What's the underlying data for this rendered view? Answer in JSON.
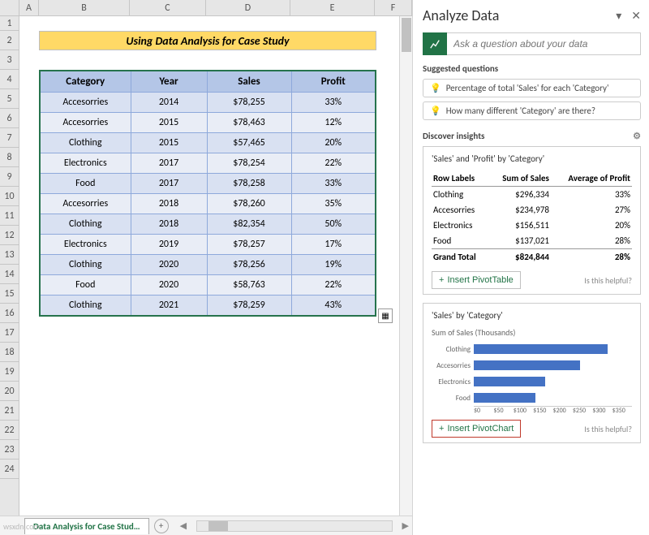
{
  "columns": [
    "A",
    "B",
    "C",
    "D",
    "E",
    "F"
  ],
  "rows": [
    "1",
    "2",
    "3",
    "4",
    "5",
    "6",
    "7",
    "8",
    "9",
    "10",
    "11",
    "12",
    "13",
    "14",
    "15",
    "16",
    "17",
    "18",
    "19",
    "20",
    "21",
    "22",
    "23",
    "24"
  ],
  "title": "Using Data Analysis for Case Study",
  "table": {
    "headers": [
      "Category",
      "Year",
      "Sales",
      "Profit"
    ],
    "rows": [
      [
        "Accesorries",
        "2014",
        "$78,255",
        "33%"
      ],
      [
        "Accesorries",
        "2015",
        "$78,463",
        "12%"
      ],
      [
        "Clothing",
        "2015",
        "$57,465",
        "20%"
      ],
      [
        "Electronics",
        "2017",
        "$78,254",
        "22%"
      ],
      [
        "Food",
        "2017",
        "$78,258",
        "33%"
      ],
      [
        "Accesorries",
        "2018",
        "$78,260",
        "35%"
      ],
      [
        "Clothing",
        "2018",
        "$82,354",
        "50%"
      ],
      [
        "Electronics",
        "2019",
        "$78,257",
        "17%"
      ],
      [
        "Clothing",
        "2020",
        "$78,256",
        "19%"
      ],
      [
        "Food",
        "2020",
        "$58,763",
        "22%"
      ],
      [
        "Clothing",
        "2021",
        "$78,259",
        "43%"
      ]
    ]
  },
  "sheet_tab": "Data Analysis for Case Stud…",
  "pane": {
    "title": "Analyze Data",
    "search_placeholder": "Ask a question about your data",
    "suggested_label": "Suggested questions",
    "suggestions": [
      "Percentage of total 'Sales' for each 'Category'",
      "How many different 'Category' are there?"
    ],
    "discover_label": "Discover insights",
    "insight1": {
      "title": "'Sales' and 'Profit' by 'Category'",
      "headers": [
        "Row Labels",
        "Sum of Sales",
        "Average of Profit"
      ],
      "rows": [
        [
          "Clothing",
          "$296,334",
          "33%"
        ],
        [
          "Accesorries",
          "$234,978",
          "27%"
        ],
        [
          "Electronics",
          "$156,511",
          "20%"
        ],
        [
          "Food",
          "$137,021",
          "28%"
        ]
      ],
      "total": [
        "Grand Total",
        "$824,844",
        "28%"
      ],
      "button": "Insert PivotTable",
      "helpful": "Is this helpful?"
    },
    "insight2": {
      "title": "'Sales' by 'Category'",
      "subtitle": "Sum of Sales (Thousands)",
      "button": "Insert PivotChart",
      "helpful": "Is this helpful?"
    }
  },
  "chart_data": {
    "type": "bar",
    "categories": [
      "Clothing",
      "Accesorries",
      "Electronics",
      "Food"
    ],
    "values": [
      296,
      235,
      157,
      137
    ],
    "title": "'Sales' by 'Category'",
    "xlabel": "",
    "ylabel": "Sum of Sales (Thousands)",
    "ylim": [
      0,
      350
    ],
    "ticks": [
      "$0",
      "$50",
      "$100",
      "$150",
      "$200",
      "$250",
      "$300",
      "$350"
    ]
  },
  "watermark": "wsxdn.com"
}
